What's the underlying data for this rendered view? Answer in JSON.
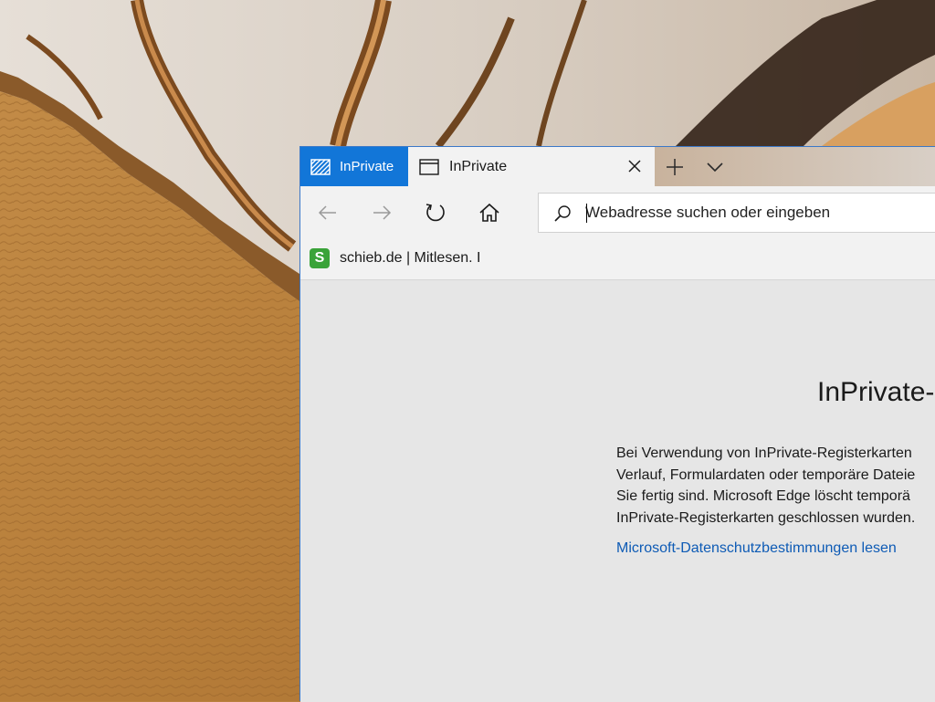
{
  "colors": {
    "inprivate_accent": "#1276d8",
    "link": "#0e5bb5",
    "window_border": "#3b78c8",
    "content_bg": "#e6e6e6",
    "favicon": "#3aa339"
  },
  "titlebar": {
    "inprivate_badge_label": "InPrivate",
    "inprivate_badge_icon": "inprivate-icon",
    "tab": {
      "title": "InPrivate",
      "icon": "page-icon",
      "close_icon": "close-icon"
    },
    "new_tab_icon": "plus-icon",
    "tab_list_icon": "chevron-down-icon"
  },
  "navbar": {
    "back_icon": "arrow-left-icon",
    "forward_icon": "arrow-right-icon",
    "refresh_icon": "refresh-icon",
    "home_icon": "home-icon",
    "address": {
      "placeholder": "Webadresse suchen oder eingeben",
      "value": "",
      "icon": "search-icon"
    }
  },
  "favorites": [
    {
      "label": "schieb.de | Mitlesen. I",
      "icon_letter": "S"
    }
  ],
  "page": {
    "heading": "InPrivate-",
    "body_lines": [
      "Bei Verwendung von InPrivate-Registerkarten",
      "Verlauf, Formulardaten oder temporäre Dateie",
      "Sie fertig sind. Microsoft Edge löscht temporä",
      "InPrivate-Registerkarten geschlossen wurden."
    ],
    "privacy_link": "Microsoft-Datenschutzbestimmungen lesen"
  }
}
